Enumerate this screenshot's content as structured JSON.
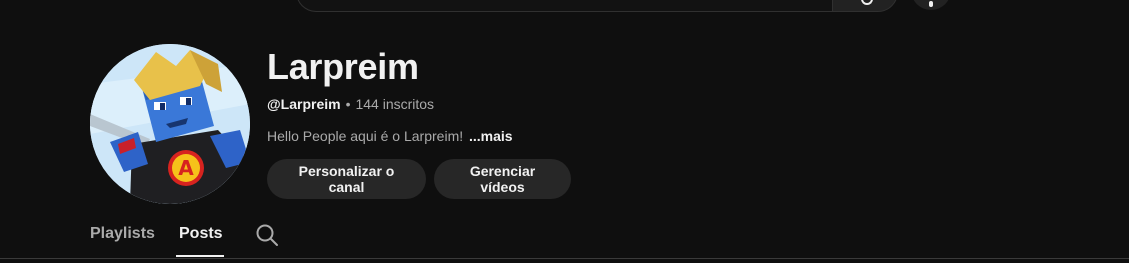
{
  "header": {
    "search_icon": "search-icon",
    "mic_icon": "microphone-icon"
  },
  "channel": {
    "name": "Larpreim",
    "handle": "@Larpreim",
    "separator": "•",
    "subscribers": "144 inscritos",
    "description": "Hello People aqui é o Larpreim!",
    "more_label": "...mais",
    "avatar_letter": "A"
  },
  "actions": {
    "customize_label": "Personalizar o canal",
    "manage_label": "Gerenciar vídeos"
  },
  "tabs": {
    "items": [
      {
        "label": "Playlists",
        "active": false
      },
      {
        "label": "Posts",
        "active": true
      }
    ],
    "search_icon": "search-icon"
  },
  "colors": {
    "background": "#0f0f0f",
    "text_primary": "#f1f1f1",
    "text_secondary": "#aaaaaa",
    "button_bg": "#272727"
  }
}
